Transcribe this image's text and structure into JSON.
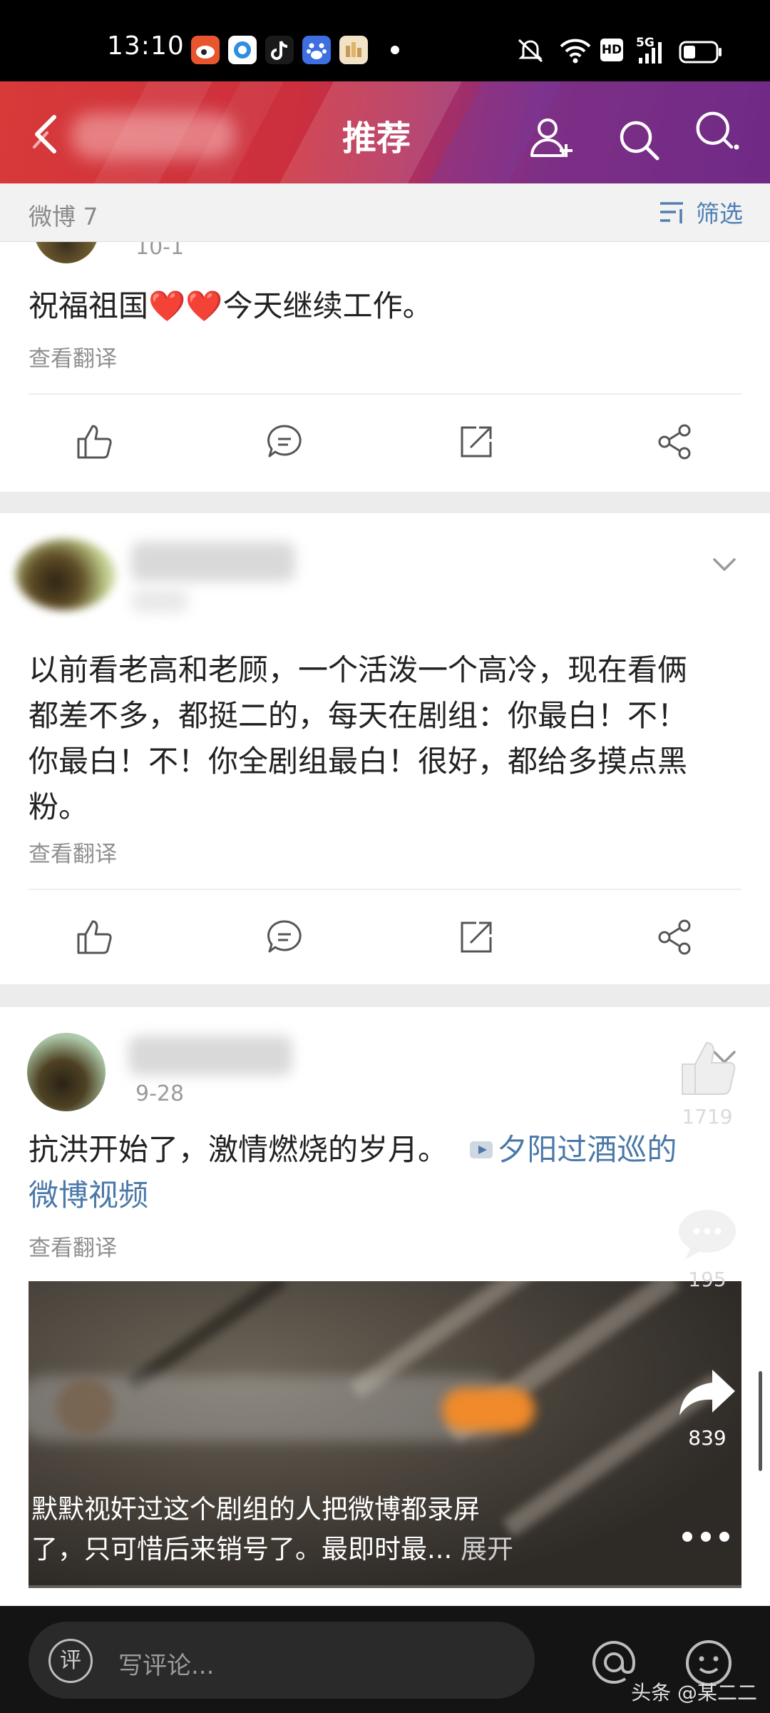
{
  "status_bar": {
    "time": "13:10",
    "notification_apps": [
      "weibo-icon",
      "browser-icon",
      "tiktok-icon",
      "baidu-icon",
      "gallery-icon"
    ],
    "hd_label": "HD",
    "network_label": "5G"
  },
  "header": {
    "title": "推荐"
  },
  "filter_bar": {
    "count_label": "微博 7",
    "filter_label": "筛选"
  },
  "posts": [
    {
      "date": "10-1",
      "text": "祝福祖国❤️❤️今天继续工作。",
      "translate_label": "查看翻译"
    },
    {
      "text_lines": [
        "以前看老高和老顾，一个活泼一个高冷，现在看俩",
        "都差不多，都挺二的，每天在剧组：你最白！不！",
        "你最白！不！你全剧组最白！很好，都给多摸点黑",
        "粉。"
      ],
      "translate_label": "查看翻译"
    },
    {
      "date": "9-28",
      "text": "抗洪开始了，激情燃烧的岁月。",
      "link_prefix": "",
      "link_line1": "夕阳过酒巡的",
      "link_line2": "微博视频",
      "translate_label": "查看翻译",
      "video_caption_line1": "默默视奸过这个剧组的人把微博都录屏",
      "video_caption_line2": "了，只可惜后来销号了。最即时最...",
      "video_expand": "展开"
    }
  ],
  "right_rail": {
    "likes": "1719",
    "comments": "195",
    "shares": "839"
  },
  "bottom_bar": {
    "comment_placeholder": "写评论...",
    "comment_badge": "评",
    "watermark": "头条 @某二二"
  },
  "colors": {
    "header_start": "#d83a3a",
    "header_end": "#6f2a86",
    "link": "#4a78a8",
    "filter_accent": "#4f7fb3"
  }
}
